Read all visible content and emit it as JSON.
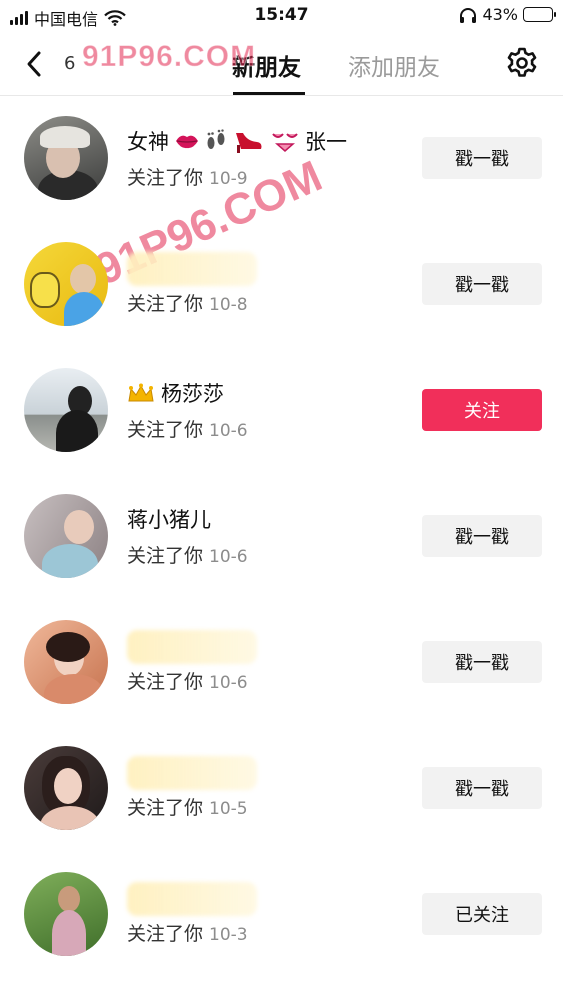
{
  "status_bar": {
    "carrier": "中国电信",
    "time": "15:47",
    "battery": "43%",
    "battery_level": 0.43
  },
  "nav": {
    "back_icon": "chevron-left-icon",
    "tabs": [
      {
        "label": "6",
        "active": false
      },
      {
        "label": "新朋友",
        "active": true
      },
      {
        "label": "添加朋友",
        "active": false
      }
    ],
    "settings_icon": "gear-icon"
  },
  "watermarks": [
    "91P96.COM",
    "91P96.COM"
  ],
  "friends": [
    {
      "name": "女神",
      "name_suffix": "张一",
      "emoji": [
        "lips-icon",
        "footprints-icon",
        "high-heel-icon",
        "bikini-icon"
      ],
      "action": "关注了你",
      "date": "10-9",
      "button": "戳一戳",
      "button_style": "grey"
    },
    {
      "name": "",
      "blurred": true,
      "action": "关注了你",
      "date": "10-8",
      "button": "戳一戳",
      "button_style": "grey"
    },
    {
      "name": "杨莎莎",
      "prefix_icon": "crown-icon",
      "action": "关注了你",
      "date": "10-6",
      "button": "关注",
      "button_style": "red"
    },
    {
      "name": "蒋小猪儿",
      "action": "关注了你",
      "date": "10-6",
      "button": "戳一戳",
      "button_style": "grey"
    },
    {
      "name": "",
      "blurred": true,
      "action": "关注了你",
      "date": "10-6",
      "button": "戳一戳",
      "button_style": "grey"
    },
    {
      "name": "",
      "blurred": true,
      "action": "关注了你",
      "date": "10-5",
      "button": "戳一戳",
      "button_style": "grey"
    },
    {
      "name": "",
      "blurred": true,
      "action": "关注了你",
      "date": "10-3",
      "button": "已关注",
      "button_style": "grey"
    }
  ],
  "colors": {
    "accent_red": "#f12f5a",
    "button_grey": "#f2f2f2",
    "date_grey": "#8c8c8c"
  }
}
